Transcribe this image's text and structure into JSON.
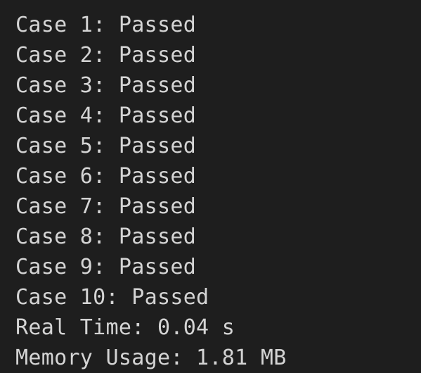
{
  "terminal": {
    "background": "#1e1e1e",
    "text_color": "#d4d4d4",
    "lines": [
      "Case 1: Passed",
      "Case 2: Passed",
      "Case 3: Passed",
      "Case 4: Passed",
      "Case 5: Passed",
      "Case 6: Passed",
      "Case 7: Passed",
      "Case 8: Passed",
      "Case 9: Passed",
      "Case 10: Passed",
      "Real Time: 0.04 s",
      "Memory Usage: 1.81 MB"
    ]
  }
}
